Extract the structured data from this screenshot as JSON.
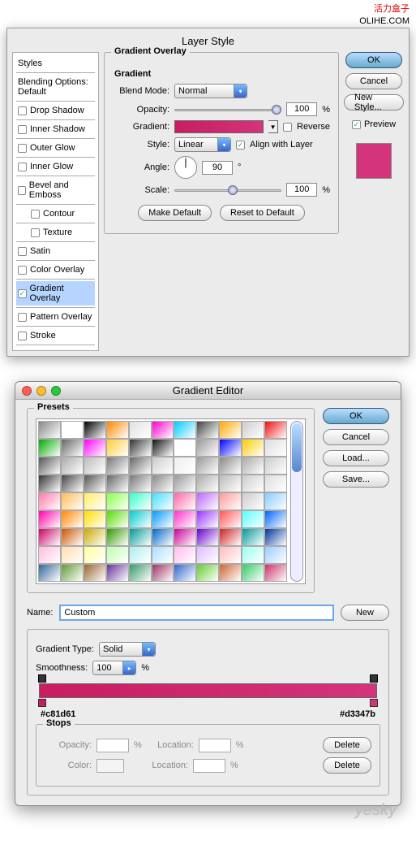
{
  "watermark_top": {
    "red": "活力盒子",
    "site": "OLIHE.COM"
  },
  "layerStyle": {
    "title": "Layer Style",
    "stylesHeader": "Styles",
    "blendingDefault": "Blending Options: Default",
    "items": [
      {
        "label": "Drop Shadow",
        "checked": false
      },
      {
        "label": "Inner Shadow",
        "checked": false
      },
      {
        "label": "Outer Glow",
        "checked": false
      },
      {
        "label": "Inner Glow",
        "checked": false
      },
      {
        "label": "Bevel and Emboss",
        "checked": false
      },
      {
        "label": "Contour",
        "checked": false,
        "indent": true
      },
      {
        "label": "Texture",
        "checked": false,
        "indent": true
      },
      {
        "label": "Satin",
        "checked": false
      },
      {
        "label": "Color Overlay",
        "checked": false
      },
      {
        "label": "Gradient Overlay",
        "checked": true,
        "selected": true
      },
      {
        "label": "Pattern Overlay",
        "checked": false
      },
      {
        "label": "Stroke",
        "checked": false
      }
    ],
    "groupTitle": "Gradient Overlay",
    "subTitle": "Gradient",
    "blendMode": {
      "label": "Blend Mode:",
      "value": "Normal"
    },
    "opacity": {
      "label": "Opacity:",
      "value": "100",
      "unit": "%"
    },
    "gradient": {
      "label": "Gradient:",
      "reverse": "Reverse",
      "start": "#c81d61",
      "end": "#d3347b"
    },
    "style": {
      "label": "Style:",
      "value": "Linear",
      "align": "Align with Layer"
    },
    "angle": {
      "label": "Angle:",
      "value": "90",
      "unit": "°"
    },
    "scale": {
      "label": "Scale:",
      "value": "100",
      "unit": "%"
    },
    "makeDefault": "Make Default",
    "resetDefault": "Reset to Default",
    "ok": "OK",
    "cancel": "Cancel",
    "newStyle": "New Style...",
    "preview": "Preview",
    "previewColor": "#d3347b"
  },
  "gradEditor": {
    "title": "Gradient Editor",
    "presets": "Presets",
    "ok": "OK",
    "cancel": "Cancel",
    "load": "Load...",
    "save": "Save...",
    "nameLabel": "Name:",
    "nameValue": "Custom",
    "new": "New",
    "gradType": {
      "label": "Gradient Type:",
      "value": "Solid"
    },
    "smooth": {
      "label": "Smoothness:",
      "value": "100",
      "unit": "%"
    },
    "hexLeft": "#c81d61",
    "hexRight": "#d3347b",
    "stops": {
      "title": "Stops",
      "opacity": "Opacity:",
      "color": "Color:",
      "location": "Location:",
      "pct": "%",
      "delete": "Delete"
    },
    "presetColors": [
      "#888",
      "#fff",
      "#000",
      "#f80",
      "#e0e0e0",
      "#f0c",
      "#0cf",
      "#444",
      "#fa0",
      "#ccc",
      "#e11",
      "#0a0",
      "#666",
      "#f0f",
      "#fc3",
      "#333",
      "#111",
      "#fff",
      "#999",
      "#00f",
      "#fc0",
      "#ddd",
      "#555",
      "#aaa",
      "#bbb",
      "#777",
      "#666",
      "#ccc",
      "#eee",
      "#999",
      "#888",
      "#aaa",
      "#ccc",
      "#333",
      "#444",
      "#555",
      "#666",
      "#777",
      "#888",
      "#999",
      "#aaa",
      "#bbb",
      "#ccc",
      "#ddd",
      "#f7a",
      "#fb5",
      "#fe6",
      "#8f4",
      "#3fc",
      "#4df",
      "#f6a",
      "#b6f",
      "#f99",
      "#ccc",
      "#8cf",
      "#f0a",
      "#f80",
      "#fd0",
      "#5d0",
      "#0cc",
      "#09f",
      "#f3c",
      "#93f",
      "#f55",
      "#5ff",
      "#06f",
      "#c06",
      "#c50",
      "#ca0",
      "#390",
      "#099",
      "#06c",
      "#c09",
      "#60c",
      "#c22",
      "#099",
      "#039",
      "#fbd",
      "#fda",
      "#ff9",
      "#bfa",
      "#aee",
      "#adf",
      "#fbe",
      "#dbf",
      "#fbb",
      "#9fe",
      "#9cf",
      "#369",
      "#693",
      "#963",
      "#639",
      "#396",
      "#936",
      "#36c",
      "#6c3",
      "#c63",
      "#3c6",
      "#c36"
    ]
  },
  "watermark_bottom": "yesky"
}
